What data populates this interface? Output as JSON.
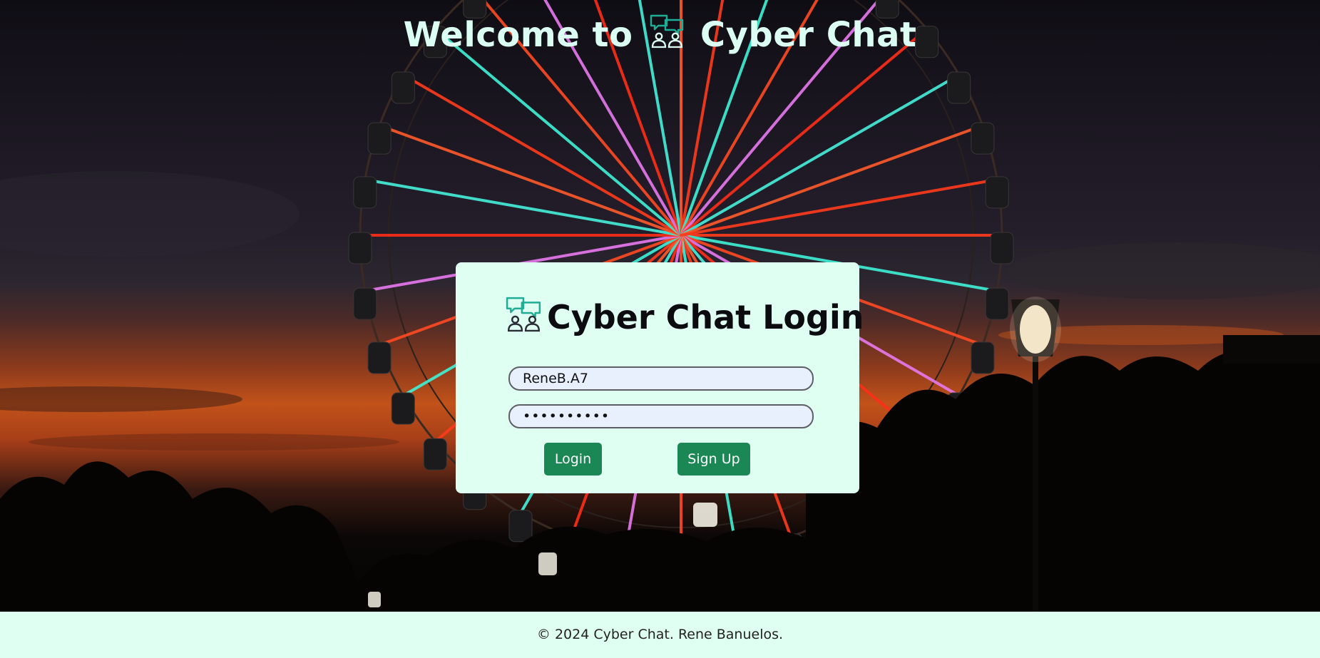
{
  "colors": {
    "accent": "#1b8754",
    "card_background": "#e0fff3",
    "footer_background": "#e0fff3",
    "input_background": "#e8f0fe",
    "welcome_text": "#dcfff3",
    "icon_teal": "#1fae95"
  },
  "header": {
    "welcome_prefix": "Welcome to",
    "welcome_brand": "Cyber Chat",
    "icon": "chat-group-icon"
  },
  "login": {
    "title": "Cyber Chat Login",
    "icon": "chat-group-icon",
    "username_value": "ReneB.A7",
    "password_value": "••••••••••",
    "login_label": "Login",
    "signup_label": "Sign Up"
  },
  "footer": {
    "text": "© 2024 Cyber Chat. Rene Banuelos."
  },
  "background": {
    "scene": "ferris-wheel-at-sunset-image"
  }
}
